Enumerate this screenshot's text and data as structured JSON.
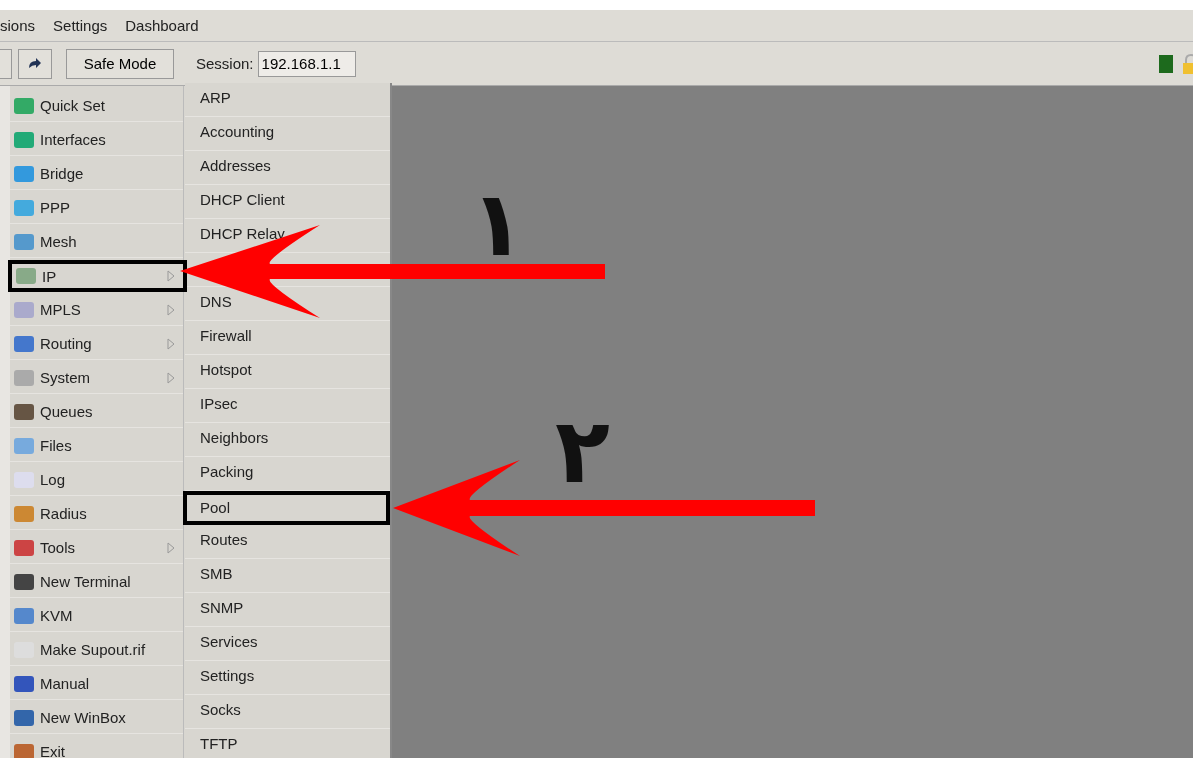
{
  "menu_bar": [
    "sions",
    "Settings",
    "Dashboard"
  ],
  "toolbar": {
    "safe_mode": "Safe Mode",
    "session_label": "Session:",
    "session_value": "192.168.1.1"
  },
  "sidebar": {
    "items": [
      {
        "label": "Quick Set",
        "submenu": false,
        "highlighted": false
      },
      {
        "label": "Interfaces",
        "submenu": false,
        "highlighted": false
      },
      {
        "label": "Bridge",
        "submenu": false,
        "highlighted": false
      },
      {
        "label": "PPP",
        "submenu": false,
        "highlighted": false
      },
      {
        "label": "Mesh",
        "submenu": false,
        "highlighted": false
      },
      {
        "label": "IP",
        "submenu": true,
        "highlighted": true
      },
      {
        "label": "MPLS",
        "submenu": true,
        "highlighted": false
      },
      {
        "label": "Routing",
        "submenu": true,
        "highlighted": false
      },
      {
        "label": "System",
        "submenu": true,
        "highlighted": false
      },
      {
        "label": "Queues",
        "submenu": false,
        "highlighted": false
      },
      {
        "label": "Files",
        "submenu": false,
        "highlighted": false
      },
      {
        "label": "Log",
        "submenu": false,
        "highlighted": false
      },
      {
        "label": "Radius",
        "submenu": false,
        "highlighted": false
      },
      {
        "label": "Tools",
        "submenu": true,
        "highlighted": false
      },
      {
        "label": "New Terminal",
        "submenu": false,
        "highlighted": false
      },
      {
        "label": "KVM",
        "submenu": false,
        "highlighted": false
      },
      {
        "label": "Make Supout.rif",
        "submenu": false,
        "highlighted": false
      },
      {
        "label": "Manual",
        "submenu": false,
        "highlighted": false
      },
      {
        "label": "New WinBox",
        "submenu": false,
        "highlighted": false
      },
      {
        "label": "Exit",
        "submenu": false,
        "highlighted": false
      }
    ]
  },
  "ip_submenu": {
    "items": [
      {
        "kind": "item",
        "label": "ARP",
        "highlighted": false
      },
      {
        "kind": "item",
        "label": "Accounting",
        "highlighted": false
      },
      {
        "kind": "item",
        "label": "Addresses",
        "highlighted": false
      },
      {
        "kind": "item",
        "label": "DHCP Client",
        "highlighted": false
      },
      {
        "kind": "item",
        "label": "DHCP Relay",
        "highlighted": false
      },
      {
        "kind": "covered"
      },
      {
        "kind": "item",
        "label": "DNS",
        "highlighted": false
      },
      {
        "kind": "item",
        "label": "Firewall",
        "highlighted": false
      },
      {
        "kind": "item",
        "label": "Hotspot",
        "highlighted": false
      },
      {
        "kind": "item",
        "label": "IPsec",
        "highlighted": false
      },
      {
        "kind": "item",
        "label": "Neighbors",
        "highlighted": false
      },
      {
        "kind": "item",
        "label": "Packing",
        "highlighted": false
      },
      {
        "kind": "item",
        "label": "Pool",
        "highlighted": true
      },
      {
        "kind": "item",
        "label": "Routes",
        "highlighted": false
      },
      {
        "kind": "item",
        "label": "SMB",
        "highlighted": false
      },
      {
        "kind": "item",
        "label": "SNMP",
        "highlighted": false
      },
      {
        "kind": "item",
        "label": "Services",
        "highlighted": false
      },
      {
        "kind": "item",
        "label": "Settings",
        "highlighted": false
      },
      {
        "kind": "item",
        "label": "Socks",
        "highlighted": false
      },
      {
        "kind": "item",
        "label": "TFTP",
        "highlighted": false
      }
    ]
  },
  "annotations": [
    {
      "number": "۱"
    },
    {
      "number": "۲"
    }
  ]
}
